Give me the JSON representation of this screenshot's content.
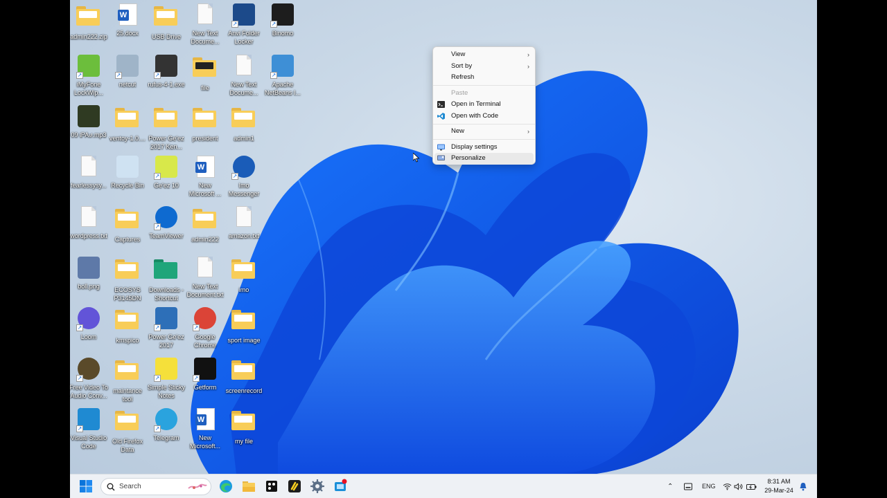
{
  "desktop_icons": [
    {
      "label": "admin222.zip",
      "icon": "zip-folder-icon"
    },
    {
      "label": "25.docx",
      "icon": "word-doc-icon"
    },
    {
      "label": "USB Drive",
      "icon": "folder-icon"
    },
    {
      "label": "New Text Docume...",
      "icon": "text-doc-icon"
    },
    {
      "label": "Anvi Folder Locker",
      "icon": "anvi-locker-icon"
    },
    {
      "label": "Binomo",
      "icon": "binomo-icon"
    },
    {
      "label": "iMyFone LockWip...",
      "icon": "imyfone-icon"
    },
    {
      "label": "netcut",
      "icon": "scissors-icon"
    },
    {
      "label": "rufus-4-1.exe",
      "icon": "usb-stick-icon"
    },
    {
      "label": "file",
      "icon": "folder-dark-icon"
    },
    {
      "label": "New Text Docume...",
      "icon": "text-doc-icon"
    },
    {
      "label": "Apache NetBeans I...",
      "icon": "netbeans-icon"
    },
    {
      "label": "09 ᎒ᏢᎪሀ.mp3",
      "icon": "album-art-icon"
    },
    {
      "label": "ventoy-1.0....",
      "icon": "folder-icon"
    },
    {
      "label": "Power Ge'ez 2017 Ken...",
      "icon": "folder-icon"
    },
    {
      "label": "president",
      "icon": "folder-icon"
    },
    {
      "label": "admin1",
      "icon": "folder-icon"
    },
    {
      "label": "fearlessysy...",
      "icon": "text-doc-icon"
    },
    {
      "label": "Recycle Bin",
      "icon": "recycle-bin-icon"
    },
    {
      "label": "Ge'ez 10",
      "icon": "geez-icon"
    },
    {
      "label": "New Microsoft ...",
      "icon": "word-doc-icon"
    },
    {
      "label": "Imo Messenger",
      "icon": "imo-icon"
    },
    {
      "label": "wordpress.txt",
      "icon": "text-doc-icon"
    },
    {
      "label": "Captures",
      "icon": "folder-icon"
    },
    {
      "label": "TeamViewer",
      "icon": "teamviewer-icon"
    },
    {
      "label": "admin222",
      "icon": "folder-icon"
    },
    {
      "label": "amazon.txt",
      "icon": "text-doc-icon"
    },
    {
      "label": "boll.png",
      "icon": "image-icon"
    },
    {
      "label": "ECOSYS P3145DN",
      "icon": "folder-icon"
    },
    {
      "label": "Downloads - Shortcut",
      "icon": "downloads-folder-icon"
    },
    {
      "label": "New Text Document.txt",
      "icon": "text-doc-icon"
    },
    {
      "label": "imo",
      "icon": "folder-icon"
    },
    {
      "label": "Loom",
      "icon": "loom-icon"
    },
    {
      "label": "kmspico",
      "icon": "folder-icon"
    },
    {
      "label": "Power Ge'ez 2017",
      "icon": "power-geez-icon"
    },
    {
      "label": "Google Chrome",
      "icon": "chrome-icon"
    },
    {
      "label": "sport image",
      "icon": "folder-icon"
    },
    {
      "label": "Free Video To Audio Conv...",
      "icon": "film-reel-icon"
    },
    {
      "label": "maintance tool",
      "icon": "folder-icon"
    },
    {
      "label": "Simple Sticky Notes",
      "icon": "sticky-notes-icon"
    },
    {
      "label": "Getform",
      "icon": "getform-icon"
    },
    {
      "label": "screenrecord",
      "icon": "folder-icon"
    },
    {
      "label": "Visual Studio Code",
      "icon": "vscode-icon"
    },
    {
      "label": "Old Firefox Data",
      "icon": "folder-icon"
    },
    {
      "label": "Telegram",
      "icon": "telegram-icon"
    },
    {
      "label": "New Microsoft...",
      "icon": "word-doc-icon"
    },
    {
      "label": "my file",
      "icon": "folder-icon"
    }
  ],
  "context_menu": {
    "items": [
      {
        "label": "View",
        "has_submenu": true
      },
      {
        "label": "Sort by",
        "has_submenu": true
      },
      {
        "label": "Refresh"
      },
      {
        "label": "Paste",
        "disabled": true
      },
      {
        "label": "Open in Terminal",
        "icon": "terminal-icon"
      },
      {
        "label": "Open with Code",
        "icon": "vscode-icon"
      },
      {
        "label": "New",
        "has_submenu": true
      },
      {
        "label": "Display settings",
        "icon": "display-icon"
      },
      {
        "label": "Personalize",
        "icon": "personalize-icon",
        "hovered": true
      }
    ]
  },
  "taskbar": {
    "search_placeholder": "Search",
    "apps": [
      "start-icon",
      "edge-icon",
      "file-explorer-icon",
      "getform-icon",
      "binomo-icon",
      "settings-icon",
      "snipping-tool-icon"
    ],
    "tray": {
      "language": "ENG"
    },
    "clock": {
      "time": "8:31 AM",
      "date": "29-Mar-24"
    }
  },
  "colors": {
    "accent": "#0067c0",
    "taskbar": "#eef1f5",
    "menu_hover": "#e9e9e9"
  }
}
